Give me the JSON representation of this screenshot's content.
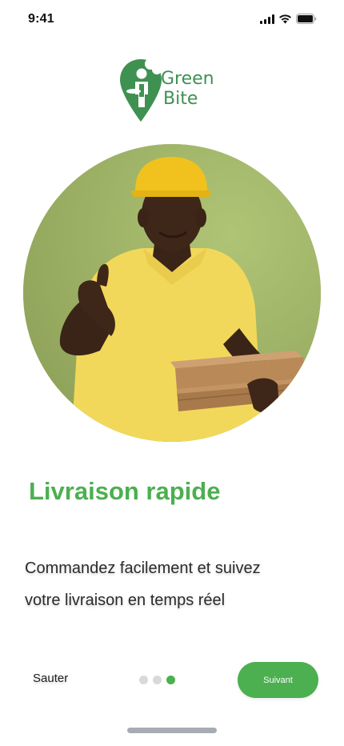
{
  "status_bar": {
    "time": "9:41",
    "icons": [
      "cellular-signal-icon",
      "wifi-icon",
      "battery-icon"
    ]
  },
  "brand": {
    "name_line1": "Green",
    "name_line2": "Bite",
    "color": "#3f9152"
  },
  "onboarding": {
    "title": "Livraison rapide",
    "description_line1": "Commandez facilement et suivez",
    "description_line2": "votre livraison en temps réel",
    "hero_image": "delivery-man-thumbs-up-with-pizza-boxes"
  },
  "footer": {
    "skip_label": "Sauter",
    "next_label": "Suivant",
    "page_count": 3,
    "active_page": 3
  },
  "colors": {
    "accent": "#4caf50",
    "dot_inactive": "#d9d9d9",
    "hero_background": "#a5b86a"
  }
}
